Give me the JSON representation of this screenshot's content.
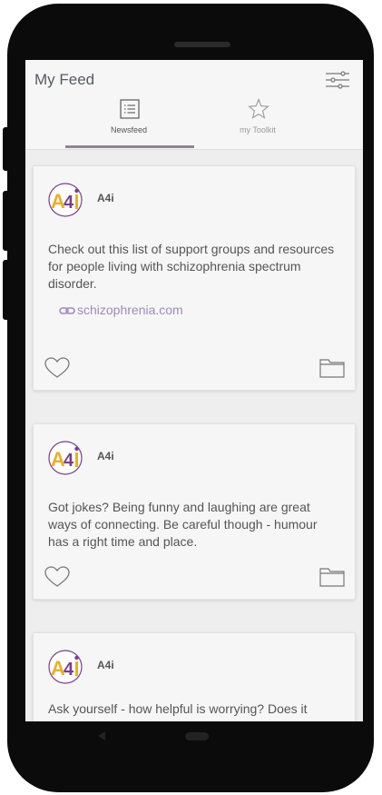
{
  "app": {
    "title": "My Feed"
  },
  "tabs": [
    {
      "label": "Newsfeed",
      "icon": "list-icon",
      "active": true
    },
    {
      "label": "my Toolkit",
      "icon": "star-icon",
      "active": false
    }
  ],
  "colors": {
    "accent": "#8e8593",
    "link": "#9f8abb",
    "text": "#555555",
    "logo_yellow": "#e8b02a",
    "logo_purple": "#7a3d8f"
  },
  "posts": [
    {
      "author": "A4i",
      "text": "Check out this list of support groups and resources for people living with schizophrenia spectrum disorder.",
      "link": "schizophrenia.com"
    },
    {
      "author": "A4i",
      "text": "Got jokes? Being funny and laughing are great ways of connecting. Be careful though - humour has a right time and place."
    },
    {
      "author": "A4i",
      "text": "Ask yourself - how helpful is worrying? Does it solve the problem or is it just a distraction?"
    }
  ]
}
